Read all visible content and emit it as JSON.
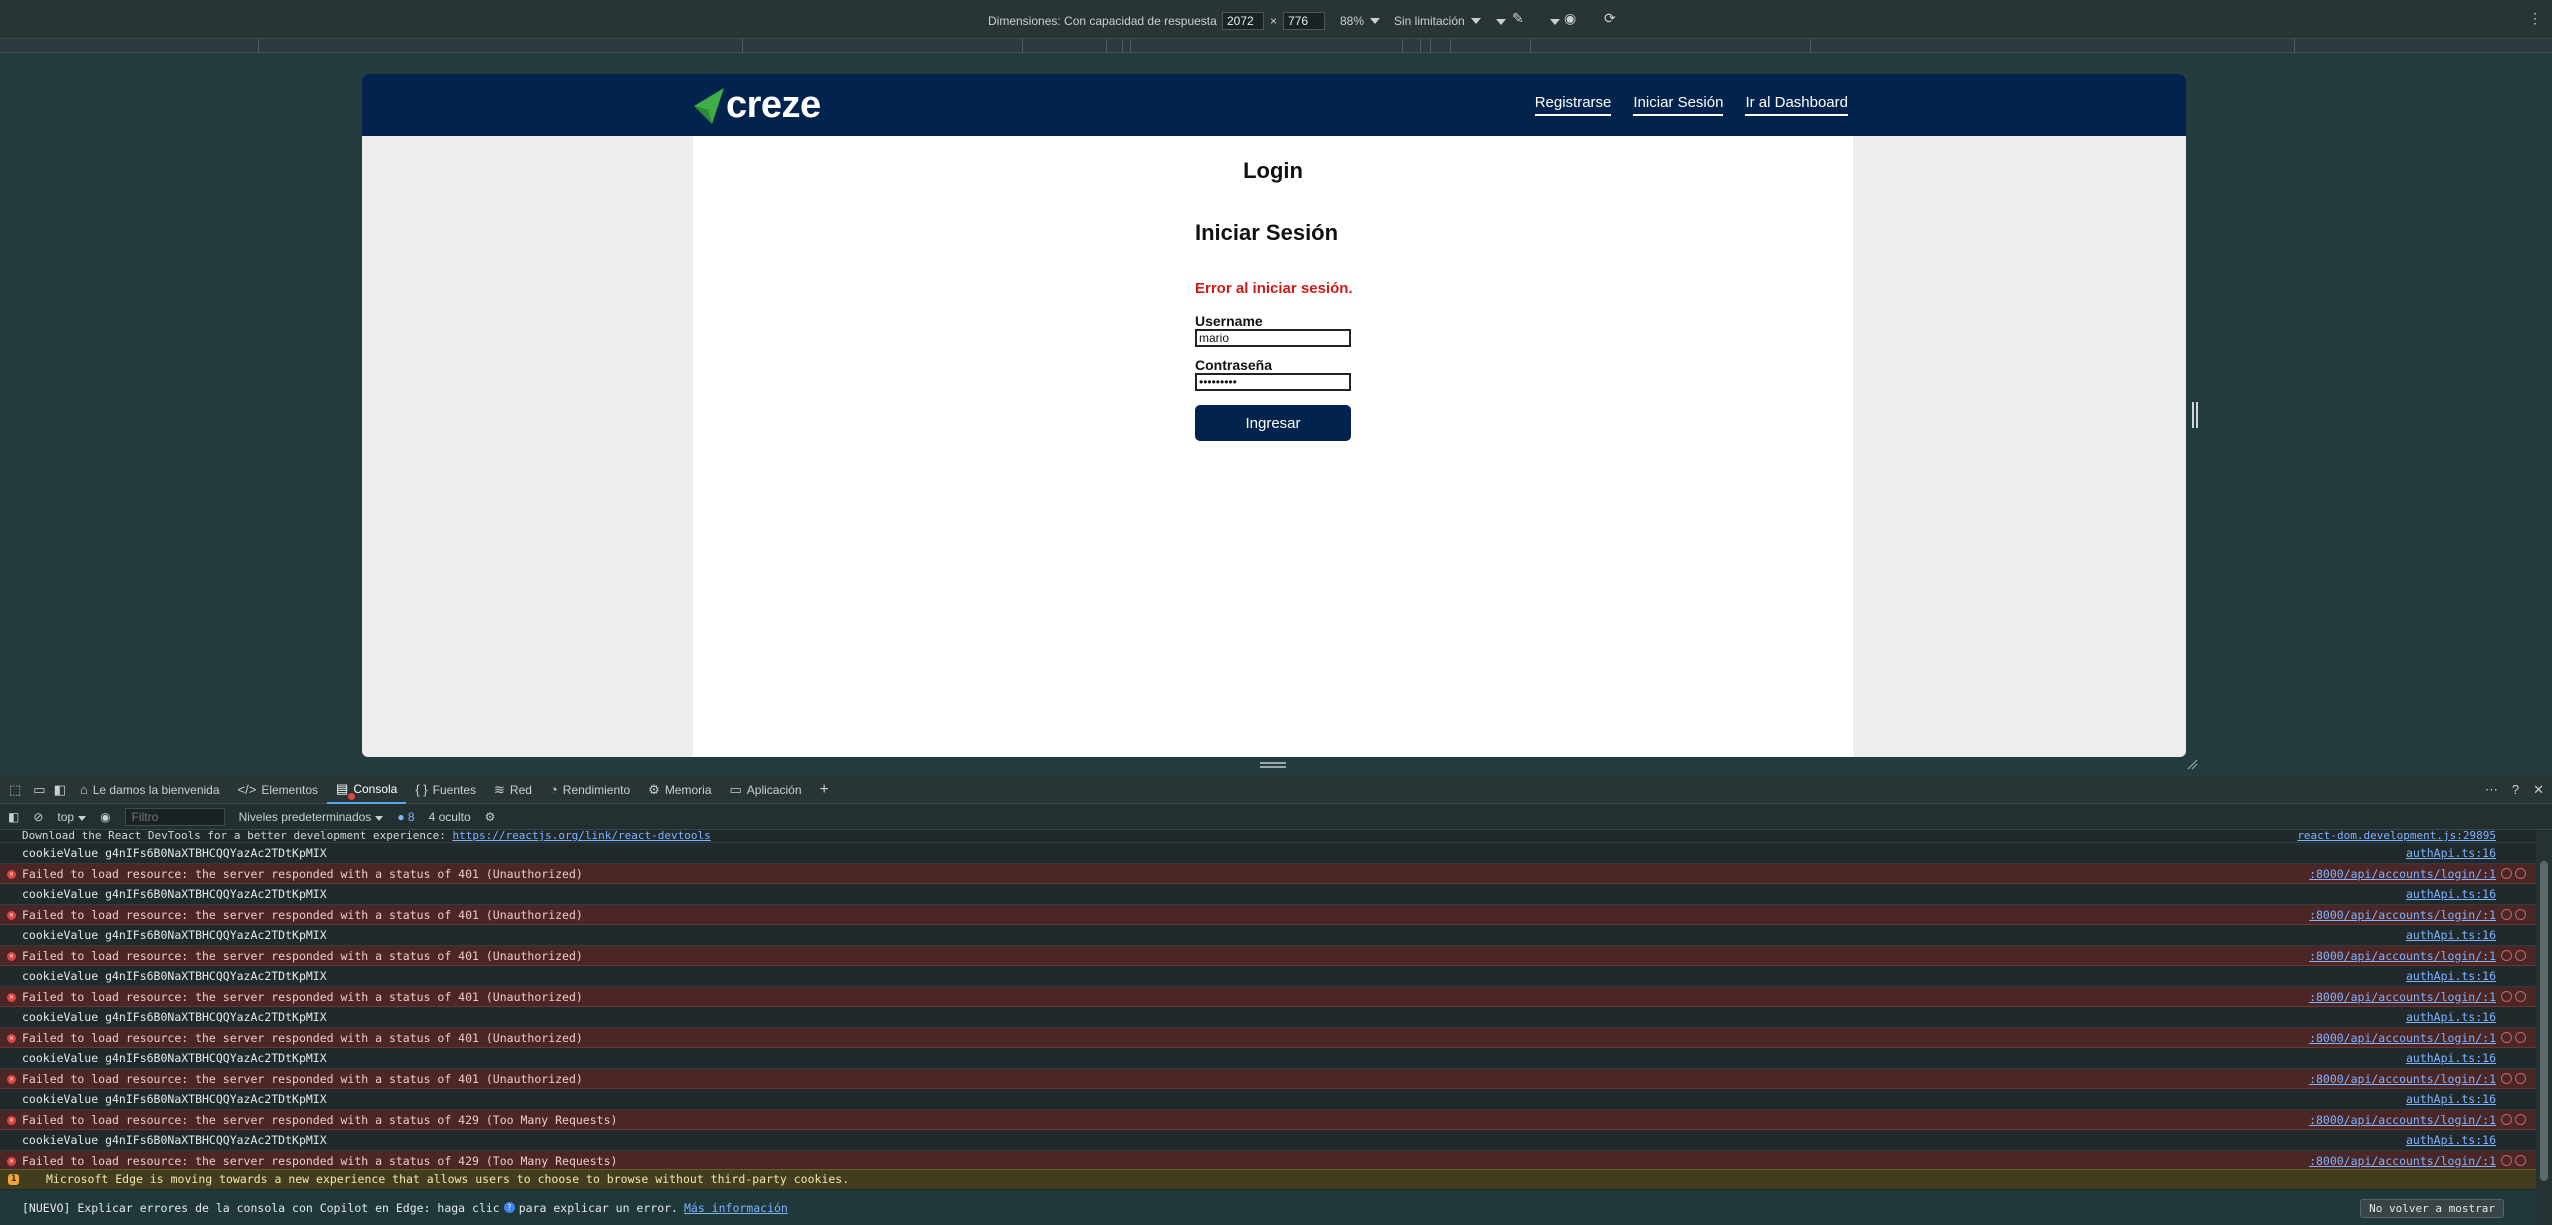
{
  "device_toolbar": {
    "dimensions_label": "Dimensiones: Con capacidad de respuesta",
    "width": "2072",
    "times": "×",
    "height": "776",
    "zoom": "88%",
    "throttle": "Sin limitación"
  },
  "site": {
    "logo_text": "creze",
    "nav": {
      "register": "Registrarse",
      "login": "Iniciar Sesión",
      "dashboard": "Ir al Dashboard"
    },
    "page_title": "Login",
    "form": {
      "heading": "Iniciar Sesión",
      "error": "Error al iniciar sesión.",
      "username_label": "Username",
      "username_value": "mario",
      "password_label": "Contraseña",
      "password_value": "•••••••••",
      "submit": "Ingresar"
    },
    "colors": {
      "header": "#03234f",
      "error": "#d11a1a",
      "logo_accent": "#3fae49"
    }
  },
  "devtools": {
    "tabs": {
      "welcome": "Le damos la bienvenida",
      "elements": "Elementos",
      "console": "Consola",
      "sources": "Fuentes",
      "network": "Red",
      "performance": "Rendimiento",
      "memory": "Memoria",
      "application": "Aplicación"
    },
    "console_toolbar": {
      "context": "top",
      "filter_placeholder": "Filtro",
      "levels": "Niveles predeterminados",
      "issues_count": "8",
      "hidden": "4 oculto"
    },
    "truncated_row": {
      "text": "Download the React DevTools for a better development experience: ",
      "link": "https://reactjs.org/link/react-devtools",
      "source": "react-dom.development.js:29895"
    },
    "rows": [
      {
        "type": "log",
        "text": "cookieValue g4nIFs6B0NaXTBHCQQYazAc2TDtKpMIX",
        "source": "authApi.ts:16"
      },
      {
        "type": "error",
        "text": "Failed to load resource: the server responded with a status of 401 (Unauthorized)",
        "source": ":8000/api/accounts/login/:1"
      },
      {
        "type": "log",
        "text": "cookieValue g4nIFs6B0NaXTBHCQQYazAc2TDtKpMIX",
        "source": "authApi.ts:16"
      },
      {
        "type": "error",
        "text": "Failed to load resource: the server responded with a status of 401 (Unauthorized)",
        "source": ":8000/api/accounts/login/:1"
      },
      {
        "type": "log",
        "text": "cookieValue g4nIFs6B0NaXTBHCQQYazAc2TDtKpMIX",
        "source": "authApi.ts:16"
      },
      {
        "type": "error",
        "text": "Failed to load resource: the server responded with a status of 401 (Unauthorized)",
        "source": ":8000/api/accounts/login/:1"
      },
      {
        "type": "log",
        "text": "cookieValue g4nIFs6B0NaXTBHCQQYazAc2TDtKpMIX",
        "source": "authApi.ts:16"
      },
      {
        "type": "error",
        "text": "Failed to load resource: the server responded with a status of 401 (Unauthorized)",
        "source": ":8000/api/accounts/login/:1"
      },
      {
        "type": "log",
        "text": "cookieValue g4nIFs6B0NaXTBHCQQYazAc2TDtKpMIX",
        "source": "authApi.ts:16"
      },
      {
        "type": "error",
        "text": "Failed to load resource: the server responded with a status of 401 (Unauthorized)",
        "source": ":8000/api/accounts/login/:1"
      },
      {
        "type": "log",
        "text": "cookieValue g4nIFs6B0NaXTBHCQQYazAc2TDtKpMIX",
        "source": "authApi.ts:16"
      },
      {
        "type": "error",
        "text": "Failed to load resource: the server responded with a status of 401 (Unauthorized)",
        "source": ":8000/api/accounts/login/:1"
      },
      {
        "type": "log",
        "text": "cookieValue g4nIFs6B0NaXTBHCQQYazAc2TDtKpMIX",
        "source": "authApi.ts:16"
      },
      {
        "type": "error",
        "text": "Failed to load resource: the server responded with a status of 429 (Too Many Requests)",
        "source": ":8000/api/accounts/login/:1"
      },
      {
        "type": "log",
        "text": "cookieValue g4nIFs6B0NaXTBHCQQYazAc2TDtKpMIX",
        "source": "authApi.ts:16"
      },
      {
        "type": "error",
        "text": "Failed to load resource: the server responded with a status of 429 (Too Many Requests)",
        "source": ":8000/api/accounts/login/:1"
      }
    ],
    "warning": {
      "badge": "1",
      "text": "Microsoft Edge is moving towards a new experience that allows users to choose to browse without third-party cookies."
    },
    "copilot": {
      "text_before": "[NUEVO] Explicar errores de la consola con Copilot en Edge: haga clic",
      "text_after": "para explicar un error.",
      "link": "Más información",
      "dismiss": "No volver a mostrar"
    }
  }
}
